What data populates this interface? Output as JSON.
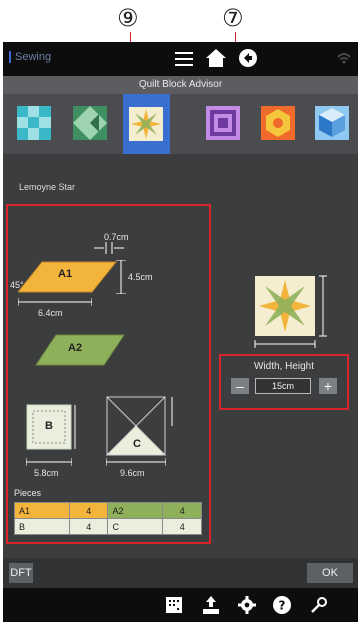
{
  "callouts": {
    "nine": "⑨",
    "seven": "⑦"
  },
  "app": {
    "name": "Sewing",
    "title": "Quilt Block Advisor",
    "block_name": "Lemoyne Star"
  },
  "toolbar": {
    "menu_icon": "menu-icon",
    "home_icon": "home-icon",
    "back_icon": "back-icon",
    "wifi_icon": "wifi-icon"
  },
  "blocks": [
    {
      "name": "checkerboard",
      "colors": [
        "#3ab8c8",
        "#9fe0e4"
      ]
    },
    {
      "name": "half-square-triangles",
      "colors": [
        "#3f8f63",
        "#9fd4b0"
      ]
    },
    {
      "name": "lemoyne-star",
      "colors": [
        "#f3b43c",
        "#8fb05a"
      ],
      "selected": true
    },
    {
      "name": "log-cabin",
      "colors": [
        "#6e3aa0",
        "#c48be6"
      ]
    },
    {
      "name": "hexagon",
      "colors": [
        "#f06a2c",
        "#f3c63c"
      ]
    },
    {
      "name": "tumbling-blocks",
      "colors": [
        "#2d77c9",
        "#8fc8f0"
      ]
    }
  ],
  "diagram": {
    "a1_label": "A1",
    "a2_label": "A2",
    "b_label": "B",
    "c_label": "C",
    "angle": "45°",
    "top_width": "0.7cm",
    "a1_height": "4.5cm",
    "a1_width": "6.4cm",
    "b_width": "5.8cm",
    "c_width": "9.6cm"
  },
  "pieces": {
    "label": "Pieces",
    "rows": [
      [
        {
          "k": "A1",
          "v": "4"
        },
        {
          "k": "A2",
          "v": "4"
        }
      ],
      [
        {
          "k": "B",
          "v": "4"
        },
        {
          "k": "C",
          "v": "4"
        }
      ]
    ]
  },
  "size": {
    "label": "Width, Height",
    "value": "15cm",
    "minus": "–",
    "plus": "+"
  },
  "footer": {
    "dft": "DFT",
    "ok": "OK"
  },
  "taskbar": {
    "icons": [
      "stitch-pattern-icon",
      "upload-icon",
      "settings-icon",
      "help-icon",
      "tools-icon"
    ]
  }
}
